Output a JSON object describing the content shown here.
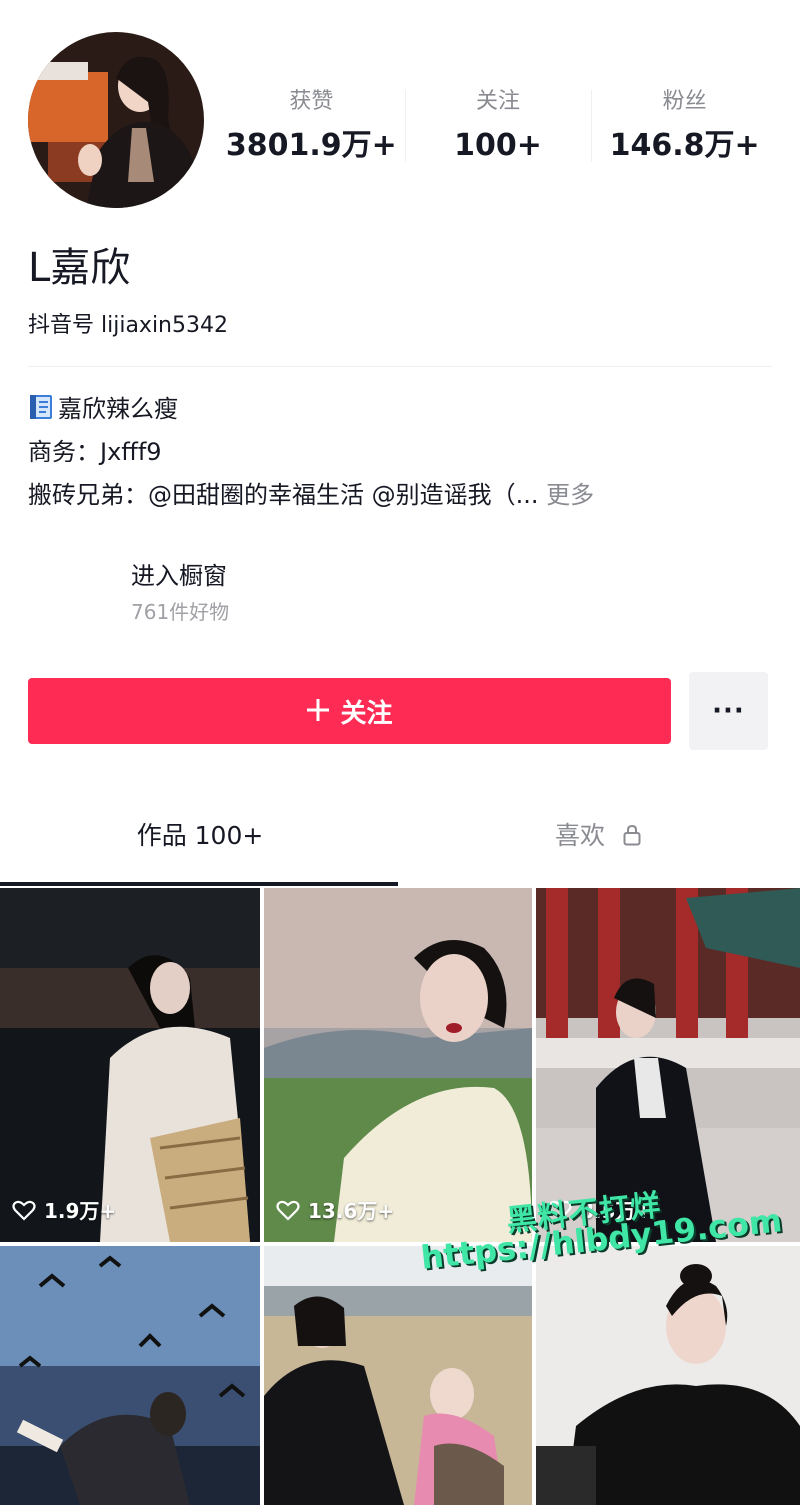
{
  "profile": {
    "nickname": "L嘉欣",
    "douyin_id": "抖音号 lijiaxin5342",
    "stats": [
      {
        "label": "获赞",
        "value": "3801.9万+"
      },
      {
        "label": "关注",
        "value": "100+"
      },
      {
        "label": "粉丝",
        "value": "146.8万+"
      }
    ]
  },
  "bio": {
    "line1": "嘉欣辣么瘦",
    "line2": "商务：Jxfff9",
    "line3": "搬砖兄弟：@田甜圈的幸福生活 @别造谣我（...",
    "more": "更多"
  },
  "shop": {
    "title": "进入橱窗",
    "subtitle": "761件好物"
  },
  "actions": {
    "follow_label": "关注",
    "follow_icon": "plus-icon",
    "more_label": "···"
  },
  "tabs": {
    "works": "作品 100+",
    "likes": "喜欢",
    "likes_icon": "lock-icon"
  },
  "videos": [
    {
      "likes": "1.9万+"
    },
    {
      "likes": "13.6万+"
    },
    {
      "likes": "8.5万+"
    },
    {
      "likes": ""
    },
    {
      "likes": ""
    },
    {
      "likes": ""
    }
  ],
  "watermark": {
    "line1": "黑料不打烊",
    "line2": "https://hlbdy19.com"
  },
  "colors": {
    "accent": "#fe2c55",
    "text": "#161823",
    "muted": "#8a8b91",
    "watermark": "#3fe6a5"
  }
}
